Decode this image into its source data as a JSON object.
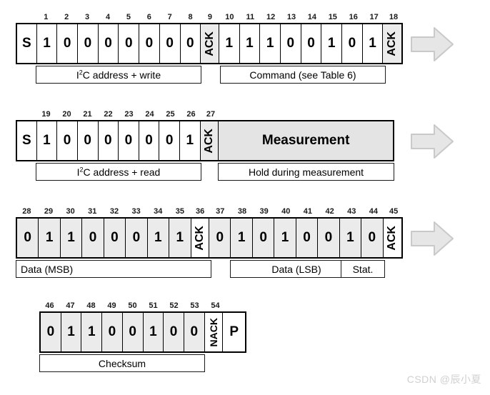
{
  "figure": {
    "title": "I2C transmission sequence diagram",
    "watermark": "CSDN @辰小夏",
    "colors": {
      "frame_border": "#000000",
      "cell_border": "#1a1a1a",
      "gray_fill": "#ebebeb",
      "measurement_fill": "#e4e4e4",
      "arrow_fill": "#e6e6e6",
      "arrow_stroke": "#c8c8c8",
      "watermark": "#d0d0d0",
      "text": "#000000"
    }
  },
  "rows": [
    {
      "id": "row-write-command",
      "numbers": [
        "",
        "1",
        "2",
        "3",
        "4",
        "5",
        "6",
        "7",
        "8",
        "9",
        "10",
        "11",
        "12",
        "13",
        "14",
        "15",
        "16",
        "17",
        "18"
      ],
      "cells": [
        {
          "text": "S",
          "fill": "white",
          "kind": "start"
        },
        {
          "text": "1",
          "fill": "white",
          "kind": "bit"
        },
        {
          "text": "0",
          "fill": "white",
          "kind": "bit"
        },
        {
          "text": "0",
          "fill": "white",
          "kind": "bit"
        },
        {
          "text": "0",
          "fill": "white",
          "kind": "bit"
        },
        {
          "text": "0",
          "fill": "white",
          "kind": "bit"
        },
        {
          "text": "0",
          "fill": "white",
          "kind": "bit"
        },
        {
          "text": "0",
          "fill": "white",
          "kind": "bit"
        },
        {
          "text": "0",
          "fill": "white",
          "kind": "bit"
        },
        {
          "text": "ACK",
          "fill": "gray",
          "kind": "ack"
        },
        {
          "text": "1",
          "fill": "white",
          "kind": "bit"
        },
        {
          "text": "1",
          "fill": "white",
          "kind": "bit"
        },
        {
          "text": "1",
          "fill": "white",
          "kind": "bit"
        },
        {
          "text": "0",
          "fill": "white",
          "kind": "bit"
        },
        {
          "text": "0",
          "fill": "white",
          "kind": "bit"
        },
        {
          "text": "1",
          "fill": "white",
          "kind": "bit"
        },
        {
          "text": "0",
          "fill": "white",
          "kind": "bit"
        },
        {
          "text": "1",
          "fill": "white",
          "kind": "bit"
        },
        {
          "text": "ACK",
          "fill": "gray",
          "kind": "ack"
        }
      ],
      "labels": [
        {
          "text": "I2C address + write",
          "sup": "2",
          "pre": "I",
          "post": "C address + write"
        },
        {
          "text": "Command (see Table 6)",
          "pre": "Command (see Table 6)",
          "sup": "",
          "post": ""
        }
      ],
      "arrow": true
    },
    {
      "id": "row-read-measurement",
      "numbers": [
        "",
        "19",
        "20",
        "21",
        "22",
        "23",
        "24",
        "25",
        "26",
        "27",
        ""
      ],
      "cells": [
        {
          "text": "S",
          "fill": "white",
          "kind": "start"
        },
        {
          "text": "1",
          "fill": "white",
          "kind": "bit"
        },
        {
          "text": "0",
          "fill": "white",
          "kind": "bit"
        },
        {
          "text": "0",
          "fill": "white",
          "kind": "bit"
        },
        {
          "text": "0",
          "fill": "white",
          "kind": "bit"
        },
        {
          "text": "0",
          "fill": "white",
          "kind": "bit"
        },
        {
          "text": "0",
          "fill": "white",
          "kind": "bit"
        },
        {
          "text": "0",
          "fill": "white",
          "kind": "bit"
        },
        {
          "text": "1",
          "fill": "white",
          "kind": "bit"
        },
        {
          "text": "ACK",
          "fill": "gray",
          "kind": "ack"
        },
        {
          "text": "Measurement",
          "fill": "measurement",
          "kind": "wide"
        }
      ],
      "labels": [
        {
          "pre": "I",
          "sup": "2",
          "post": "C address + read"
        },
        {
          "pre": "Hold during measurement",
          "sup": "",
          "post": ""
        }
      ],
      "arrow": true
    },
    {
      "id": "row-data",
      "numbers": [
        "28",
        "29",
        "30",
        "31",
        "32",
        "33",
        "34",
        "35",
        "36",
        "37",
        "38",
        "39",
        "40",
        "41",
        "42",
        "43",
        "44",
        "45"
      ],
      "cells": [
        {
          "text": "0",
          "fill": "gray",
          "kind": "bit"
        },
        {
          "text": "1",
          "fill": "gray",
          "kind": "bit"
        },
        {
          "text": "1",
          "fill": "gray",
          "kind": "bit"
        },
        {
          "text": "0",
          "fill": "gray",
          "kind": "bit"
        },
        {
          "text": "0",
          "fill": "gray",
          "kind": "bit"
        },
        {
          "text": "0",
          "fill": "gray",
          "kind": "bit"
        },
        {
          "text": "1",
          "fill": "gray",
          "kind": "bit"
        },
        {
          "text": "1",
          "fill": "gray",
          "kind": "bit"
        },
        {
          "text": "ACK",
          "fill": "white",
          "kind": "ack"
        },
        {
          "text": "0",
          "fill": "gray",
          "kind": "bit"
        },
        {
          "text": "1",
          "fill": "gray",
          "kind": "bit"
        },
        {
          "text": "0",
          "fill": "gray",
          "kind": "bit"
        },
        {
          "text": "1",
          "fill": "gray",
          "kind": "bit"
        },
        {
          "text": "0",
          "fill": "gray",
          "kind": "bit"
        },
        {
          "text": "0",
          "fill": "gray",
          "kind": "bit"
        },
        {
          "text": "1",
          "fill": "gray",
          "kind": "bit"
        },
        {
          "text": "0",
          "fill": "gray",
          "kind": "bit"
        },
        {
          "text": "ACK",
          "fill": "white",
          "kind": "ack"
        }
      ],
      "labels": [
        {
          "pre": "Data (MSB)",
          "sup": "",
          "post": ""
        },
        {
          "pre": "Data (LSB)",
          "sup": "",
          "post": ""
        },
        {
          "pre": "Stat.",
          "sup": "",
          "post": ""
        }
      ],
      "arrow": true
    },
    {
      "id": "row-checksum",
      "numbers": [
        "46",
        "47",
        "48",
        "49",
        "50",
        "51",
        "52",
        "53",
        "54",
        ""
      ],
      "cells": [
        {
          "text": "0",
          "fill": "gray",
          "kind": "bit"
        },
        {
          "text": "1",
          "fill": "gray",
          "kind": "bit"
        },
        {
          "text": "1",
          "fill": "gray",
          "kind": "bit"
        },
        {
          "text": "0",
          "fill": "gray",
          "kind": "bit"
        },
        {
          "text": "0",
          "fill": "gray",
          "kind": "bit"
        },
        {
          "text": "1",
          "fill": "gray",
          "kind": "bit"
        },
        {
          "text": "0",
          "fill": "gray",
          "kind": "bit"
        },
        {
          "text": "0",
          "fill": "gray",
          "kind": "bit"
        },
        {
          "text": "NACK",
          "fill": "white",
          "kind": "ack"
        },
        {
          "text": "P",
          "fill": "white",
          "kind": "stop"
        }
      ],
      "labels": [
        {
          "pre": "Checksum",
          "sup": "",
          "post": ""
        }
      ],
      "arrow": false
    }
  ]
}
